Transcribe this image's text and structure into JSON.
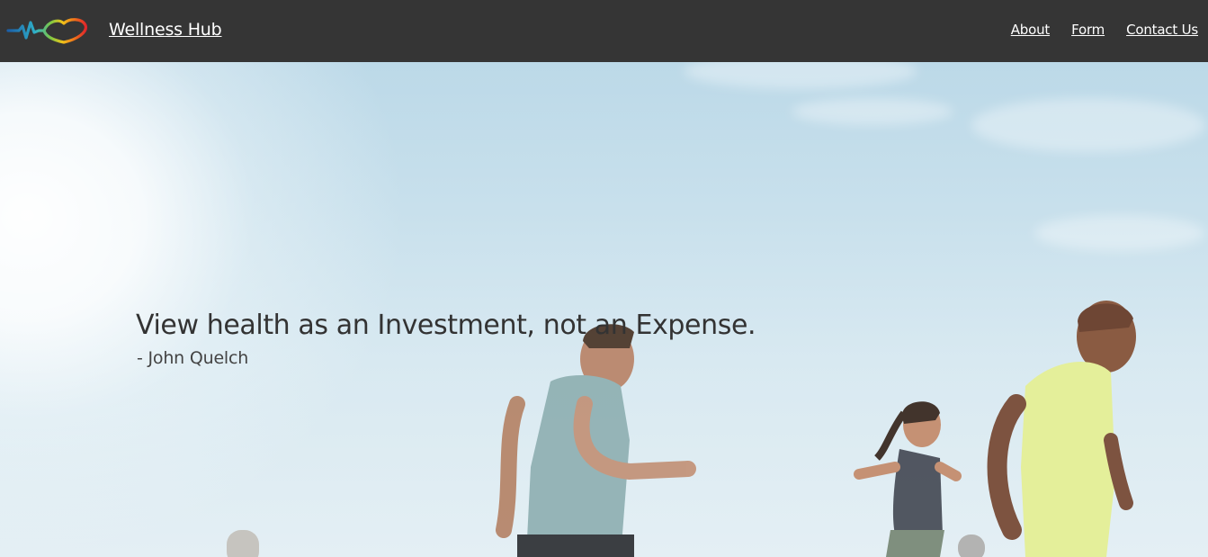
{
  "navbar": {
    "brand": "Wellness Hub",
    "links": [
      {
        "label": "About"
      },
      {
        "label": "Form"
      },
      {
        "label": "Contact Us"
      }
    ],
    "background": "#353535"
  },
  "hero": {
    "quote": "View health as an Investment, not an Expense.",
    "author": "- John Quelch"
  },
  "icons": {
    "logo": "heartbeat-heart-logo"
  },
  "colors": {
    "text_dark": "#333333",
    "nav_text": "#ffffff",
    "sky": "#bcd9e8"
  }
}
